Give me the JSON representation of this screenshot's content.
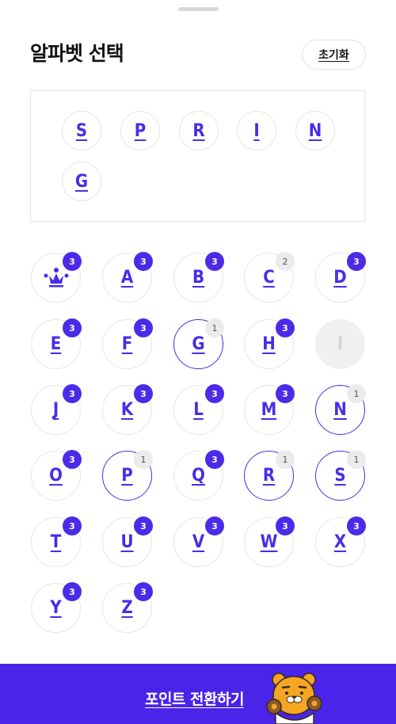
{
  "header": {
    "title": "알파벳 선택",
    "reset_label": "초기화"
  },
  "selected_letters": [
    "S",
    "P",
    "R",
    "I",
    "N",
    "G"
  ],
  "keyboard": {
    "keys": [
      {
        "letter": "",
        "icon": "crown-icon",
        "count": "3",
        "state": "available"
      },
      {
        "letter": "A",
        "count": "3",
        "state": "available"
      },
      {
        "letter": "B",
        "count": "3",
        "state": "available"
      },
      {
        "letter": "C",
        "count": "2",
        "state": "available"
      },
      {
        "letter": "D",
        "count": "3",
        "state": "available"
      },
      {
        "letter": "E",
        "count": "3",
        "state": "available"
      },
      {
        "letter": "F",
        "count": "3",
        "state": "available"
      },
      {
        "letter": "G",
        "count": "1",
        "state": "selected"
      },
      {
        "letter": "H",
        "count": "3",
        "state": "available"
      },
      {
        "letter": "I",
        "count": "",
        "state": "disabled"
      },
      {
        "letter": "J",
        "count": "3",
        "state": "available"
      },
      {
        "letter": "K",
        "count": "3",
        "state": "available"
      },
      {
        "letter": "L",
        "count": "3",
        "state": "available"
      },
      {
        "letter": "M",
        "count": "3",
        "state": "available"
      },
      {
        "letter": "N",
        "count": "1",
        "state": "selected"
      },
      {
        "letter": "O",
        "count": "3",
        "state": "available"
      },
      {
        "letter": "P",
        "count": "1",
        "state": "selected"
      },
      {
        "letter": "Q",
        "count": "3",
        "state": "available"
      },
      {
        "letter": "R",
        "count": "1",
        "state": "selected"
      },
      {
        "letter": "S",
        "count": "1",
        "state": "selected"
      },
      {
        "letter": "T",
        "count": "3",
        "state": "available"
      },
      {
        "letter": "U",
        "count": "3",
        "state": "available"
      },
      {
        "letter": "V",
        "count": "3",
        "state": "available"
      },
      {
        "letter": "W",
        "count": "3",
        "state": "available"
      },
      {
        "letter": "X",
        "count": "3",
        "state": "available"
      },
      {
        "letter": "Y",
        "count": "3",
        "state": "available"
      },
      {
        "letter": "Z",
        "count": "3",
        "state": "available"
      }
    ]
  },
  "cta": {
    "label": "포인트 전환하기",
    "mascot": "ryan-bear-mascot"
  },
  "colors": {
    "accent": "#4a24e8",
    "badge_light": "#ebebeb",
    "disabled": "#f0f0f0"
  }
}
